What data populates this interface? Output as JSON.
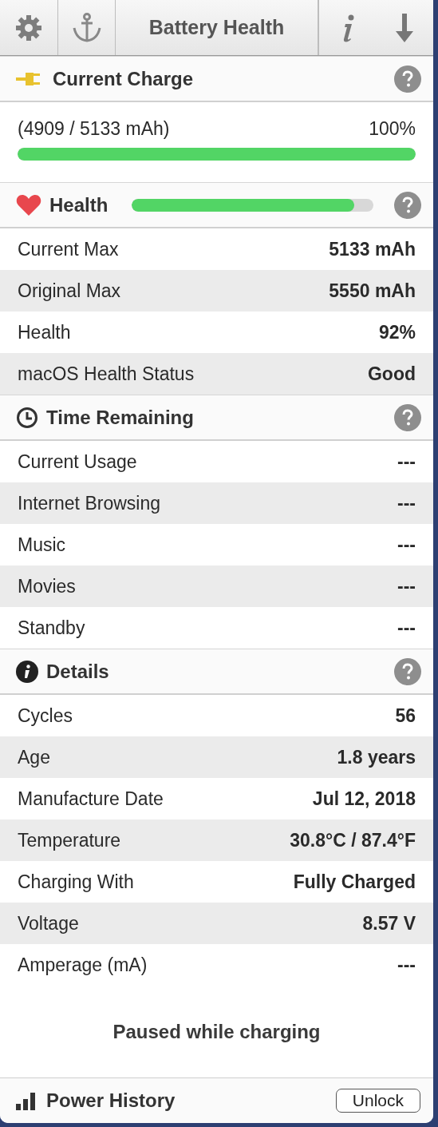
{
  "toolbar": {
    "title": "Battery Health"
  },
  "charge": {
    "title": "Current Charge",
    "kind": "plug",
    "reading": "(4909 / 5133 mAh)",
    "percent": "100%",
    "level": 1.0
  },
  "sections": [
    {
      "title": "Health",
      "kind": "heart",
      "level": 0.92,
      "rows": [
        {
          "label": "Current Max",
          "value": "5133 mAh"
        },
        {
          "label": "Original Max",
          "value": "5550 mAh"
        },
        {
          "label": "Health",
          "value": "92%"
        },
        {
          "label": "macOS Health Status",
          "value": "Good"
        }
      ]
    },
    {
      "title": "Time Remaining",
      "kind": "clock",
      "rows": [
        {
          "label": "Current Usage",
          "value": "---"
        },
        {
          "label": "Internet Browsing",
          "value": "---"
        },
        {
          "label": "Music",
          "value": "---"
        },
        {
          "label": "Movies",
          "value": "---"
        },
        {
          "label": "Standby",
          "value": "---"
        }
      ]
    },
    {
      "title": "Details",
      "kind": "info",
      "rows": [
        {
          "label": "Cycles",
          "value": "56"
        },
        {
          "label": "Age",
          "value": "1.8 years"
        },
        {
          "label": "Manufacture Date",
          "value": "Jul 12, 2018"
        },
        {
          "label": "Temperature",
          "value": "30.8°C / 87.4°F"
        },
        {
          "label": "Charging With",
          "value": "Fully Charged"
        },
        {
          "label": "Voltage",
          "value": "8.57 V"
        },
        {
          "label": "Amperage (mA)",
          "value": "---"
        }
      ]
    }
  ],
  "status": "Paused while charging",
  "footer": {
    "title": "Power History",
    "button": "Unlock"
  }
}
